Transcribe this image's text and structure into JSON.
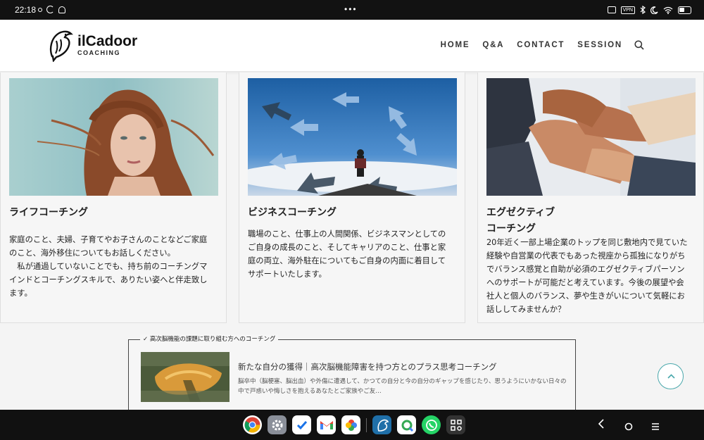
{
  "status_bar": {
    "time": "22:18",
    "vpn_label": "VPN"
  },
  "header": {
    "logo_name": "ilCadoor",
    "logo_sub": "COACHING",
    "nav": [
      "HOME",
      "Q&A",
      "CONTACT",
      "SESSION"
    ]
  },
  "cards": [
    {
      "title": "ライフコーチング",
      "body": "家庭のこと、夫婦、子育てやお子さんのことなどご家庭のこと、海外移住についてもお話しください。\n　私が通過していないことでも、持ち前のコーチングマインドとコーチングスキルで、ありたい姿へと伴走致します。"
    },
    {
      "title": "ビジネスコーチング",
      "body": "職場のこと、仕事上の人間関係、ビジネスマンとしてのご自身の成長のこと、そしてキャリアのこと、仕事と家庭の両立、海外駐在についてもご自身の内面に着目してサポートいたします。"
    },
    {
      "title": "エグゼクティブ\nコーチング",
      "body": "20年近く一部上場企業のトップを同じ敷地内で見ていた経験や自営業の代表でもあった視座から孤独になりがちでバランス感覚と自助が必須のエグゼクティブパーソンへのサポートが可能だと考えています。今後の展望や会社人と個人のバランス、夢や生きがいについて気軽にお話ししてみませんか？"
    }
  ],
  "related": {
    "label": "✓ 高次脳機能の課題に取り組む方へのコーチング",
    "title": "新たな自分の獲得｜高次脳機能障害を持つ方とのプラス思考コーチング",
    "desc": "脳卒中（脳梗塞、脳出血）や外傷に遭遇して、かつての自分と今の自分のギャップを感じたり、思うようにいかない日々の中で戸惑いや悔しさを抱えるあなたとご家族やご友…"
  },
  "dock_apps": [
    "chrome-icon",
    "settings-icon",
    "tasks-icon",
    "gmail-icon",
    "photos-icon",
    "ilcadoor-app-icon",
    "lens-icon",
    "whatsapp-icon",
    "qr-scanner-icon"
  ],
  "colors": {
    "accent": "#4aa8ac",
    "statusbar": "#121212",
    "navbar": "#111111"
  }
}
